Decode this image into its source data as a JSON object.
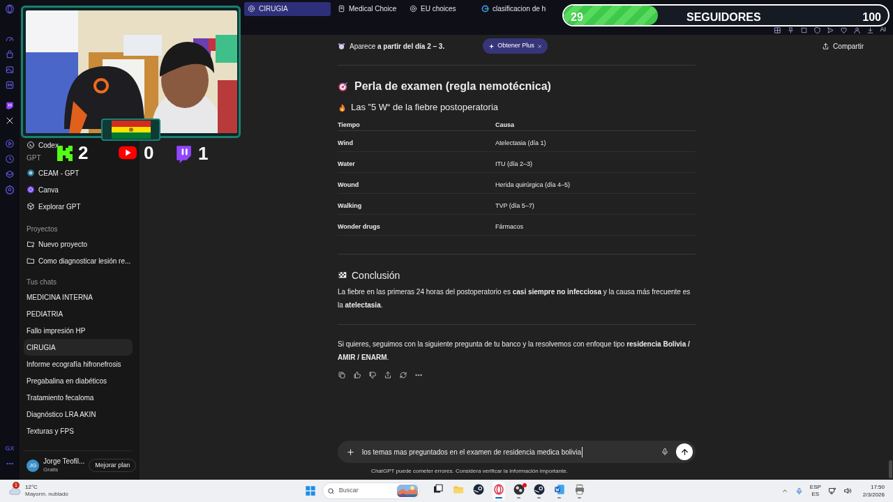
{
  "browser": {
    "tabs": [
      {
        "label": "CIRUGIA",
        "kind": "gpt",
        "selected": true
      },
      {
        "label": "Medical Choice",
        "kind": "doc",
        "selected": false
      },
      {
        "label": "EU choices",
        "kind": "gpt",
        "selected": false
      },
      {
        "label": "clasificacion de hi",
        "kind": "google",
        "selected": false
      }
    ],
    "toolbar_label": "AI"
  },
  "rail": {
    "label": "GX"
  },
  "sidebar": {
    "top_item": {
      "label": "Codex",
      "kind": "codex"
    },
    "sections": [
      {
        "heading": "GPT",
        "items": [
          {
            "label": "CEAM - GPT",
            "kind": "globe"
          },
          {
            "label": "Canva",
            "kind": "canva"
          },
          {
            "label": "Explorar GPT",
            "kind": "cube"
          }
        ]
      },
      {
        "heading": "Proyectos",
        "items": [
          {
            "label": "Nuevo proyecto",
            "kind": "new-folder"
          },
          {
            "label": "Como diagnosticar lesión re...",
            "kind": "folder"
          }
        ]
      }
    ],
    "chats_heading": "Tus chats",
    "chats": [
      {
        "label": "MEDICINA INTERNA",
        "selected": false
      },
      {
        "label": "PEDIATRIA",
        "selected": false
      },
      {
        "label": "Fallo impresión HP",
        "selected": false
      },
      {
        "label": "CIRUGIA",
        "selected": true
      },
      {
        "label": "Informe ecografía hifronefrosis",
        "selected": false
      },
      {
        "label": "Pregabalina en diabéticos",
        "selected": false
      },
      {
        "label": "Tratamiento fecaloma",
        "selected": false
      },
      {
        "label": "Diagnóstico LRA AKIN",
        "selected": false
      },
      {
        "label": "Texturas y FPS",
        "selected": false
      }
    ],
    "user": {
      "initials": "JG",
      "name": "Jorge Teofil...",
      "plan": "Gratis",
      "upgrade": "Mejorar plan"
    }
  },
  "chat": {
    "note": "Aparece **a partir del día 2 – 3.**",
    "plus_pill": "Obtener Plus",
    "share": "Compartir",
    "heading": "Perla de examen (regla nemotécnica)",
    "subheading": "Las ”5 W“ de la fiebre postoperatoria",
    "table": {
      "columns": [
        "Tiempo",
        "Causa"
      ],
      "rows": [
        [
          "Wind",
          "Atelectasia (día 1)"
        ],
        [
          "Water",
          "ITU (día 2–3)"
        ],
        [
          "Wound",
          "Herida quirúrgica (día 4–5)"
        ],
        [
          "Walking",
          "TVP (día 5–7)"
        ],
        [
          "Wonder drugs",
          "Fármacos"
        ]
      ]
    },
    "conclusion_heading": "Conclusión",
    "conclusion": "La fiebre en las primeras 24 horas del postoperatorio es **casi siempre no infecciosa** y la causa más frecuente es la **atelectasia**.",
    "follow_up": "Si quieres, seguimos con la siguiente pregunta de tu banco y la resolvemos con enfoque tipo **residencia Bolivia / AMIR / ENARM**.",
    "composer": {
      "value": "los temas mas preguntados en el examen de residencia medica bolivia",
      "disclaimer": "ChatGPT puede cometer errores. Considera verificar la información importante."
    }
  },
  "stream_overlay": {
    "followers": {
      "count": "29",
      "label": "SEGUIDORES",
      "goal": "100",
      "level": 0.29
    },
    "counters": [
      {
        "kind": "kick",
        "count": "2"
      },
      {
        "kind": "youtube",
        "count": "0"
      },
      {
        "kind": "twitch",
        "count": "1"
      }
    ]
  },
  "taskbar": {
    "weather": {
      "badge": "1",
      "temperature": "12°C",
      "condition": "Mayorm. nublado"
    },
    "search": {
      "placeholder": "Buscar"
    },
    "apps": [
      {
        "kind": "taskview",
        "selected": false,
        "running": false,
        "notification": false
      },
      {
        "kind": "files",
        "selected": false,
        "running": false,
        "notification": false
      },
      {
        "kind": "steam",
        "selected": false,
        "running": false,
        "notification": false
      },
      {
        "kind": "opera",
        "selected": true,
        "running": true,
        "notification": false
      },
      {
        "kind": "obs",
        "selected": false,
        "running": true,
        "notification": true
      },
      {
        "kind": "steam",
        "selected": false,
        "running": true,
        "notification": false
      },
      {
        "kind": "word",
        "selected": false,
        "running": true,
        "notification": false
      },
      {
        "kind": "printer",
        "selected": false,
        "running": true,
        "notification": false
      }
    ],
    "language": {
      "top": "ESP",
      "bottom": "ES"
    },
    "time": "17:50",
    "date": "2/3/2026"
  }
}
